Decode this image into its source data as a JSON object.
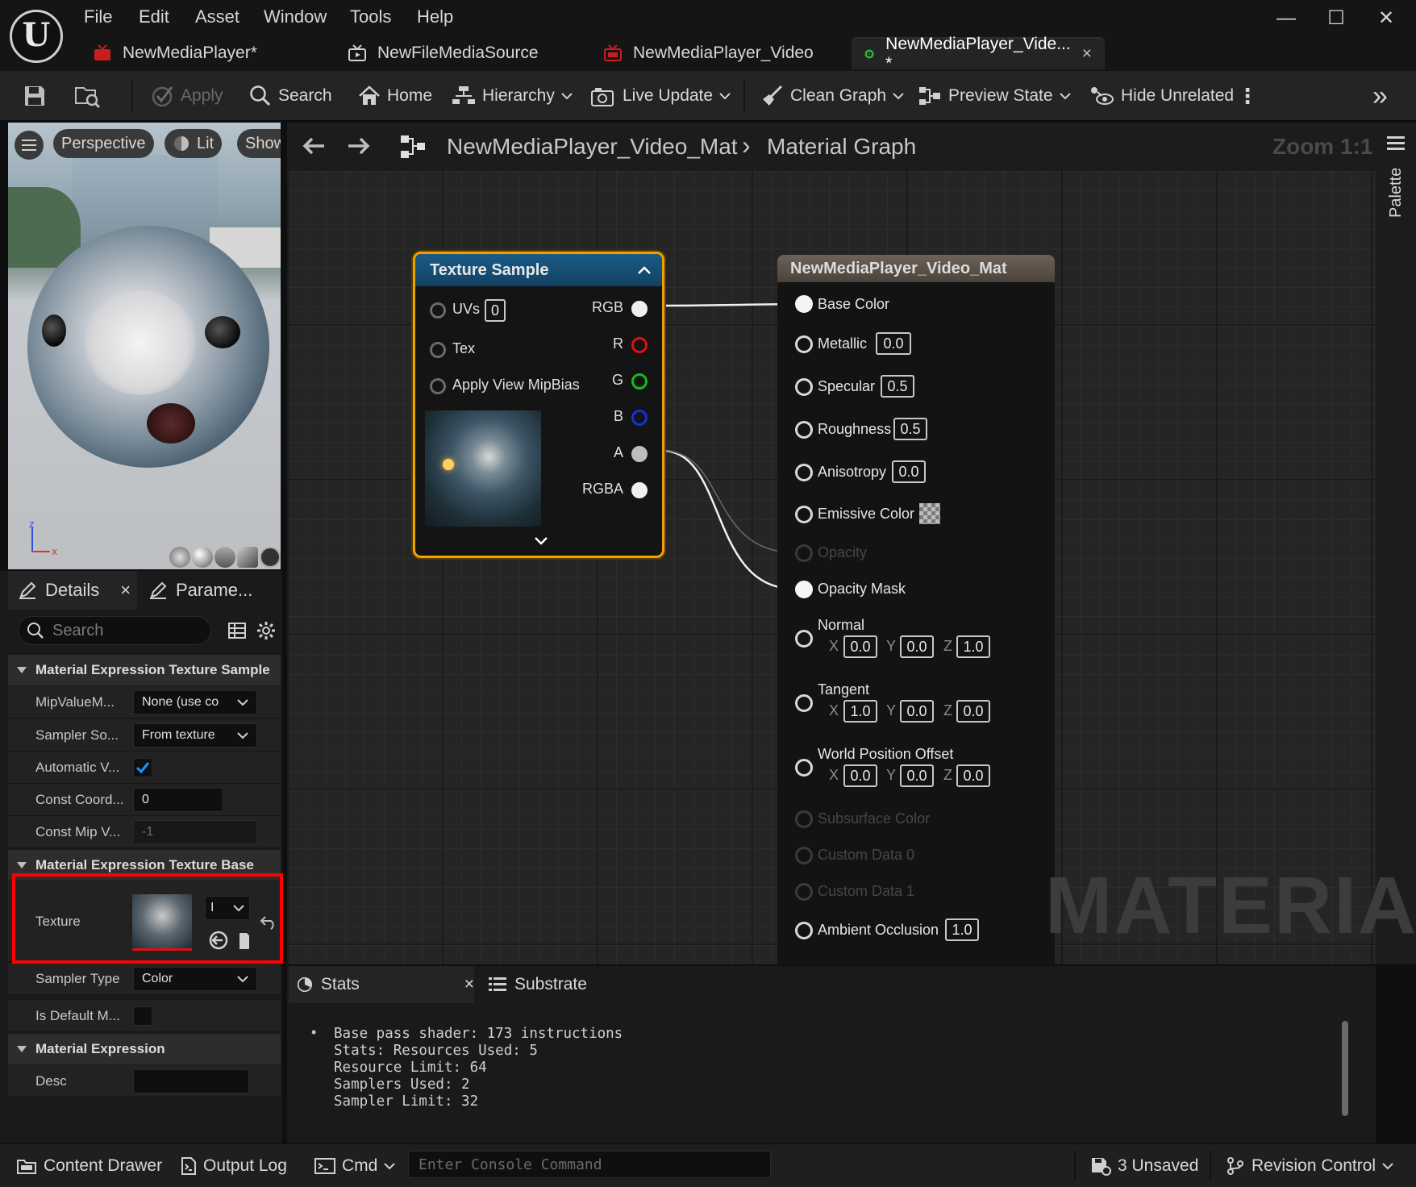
{
  "menu": [
    "File",
    "Edit",
    "Asset",
    "Window",
    "Tools",
    "Help"
  ],
  "window_controls": {
    "minimize": "—",
    "maximize": "☐",
    "close": "✕"
  },
  "tabs": [
    {
      "label": "NewMediaPlayer*"
    },
    {
      "label": "NewFileMediaSource"
    },
    {
      "label": "NewMediaPlayer_Video"
    },
    {
      "label": "NewMediaPlayer_Vide... *",
      "close": "×"
    }
  ],
  "toolbar": {
    "apply": "Apply",
    "search": "Search",
    "home": "Home",
    "hierarchy": "Hierarchy",
    "live_update": "Live Update",
    "clean_graph": "Clean Graph",
    "preview_state": "Preview State",
    "hide_unrelated": "Hide Unrelated",
    "more": "⋮",
    "expand": "»"
  },
  "viewport": {
    "perspective": "Perspective",
    "lit": "Lit",
    "show": "Show"
  },
  "details": {
    "tab_details": "Details",
    "tab_close": "×",
    "tab_parameters": "Parame...",
    "search_placeholder": "Search",
    "categories": {
      "texture_sample": "Material Expression Texture Sample",
      "texture_base": "Material Expression Texture Base",
      "expression": "Material Expression"
    },
    "rows": {
      "mip_value_mode": {
        "label": "MipValueM...",
        "value": "None (use co"
      },
      "sampler_source": {
        "label": "Sampler So...",
        "value": "From texture"
      },
      "automatic_view": {
        "label": "Automatic V...",
        "checked": true
      },
      "const_coord": {
        "label": "Const Coord...",
        "value": "0"
      },
      "const_mip": {
        "label": "Const Mip V...",
        "value": "-1"
      },
      "texture": {
        "label": "Texture",
        "value": "I"
      },
      "sampler_type": {
        "label": "Sampler Type",
        "value": "Color"
      },
      "is_default": {
        "label": "Is Default M..."
      },
      "desc": {
        "label": "Desc",
        "value": ""
      }
    }
  },
  "graph": {
    "breadcrumb_asset": "NewMediaPlayer_Video_Mat",
    "breadcrumb_sep": "›",
    "breadcrumb_graph": "Material Graph",
    "zoom": "Zoom 1:1",
    "palette": "Palette",
    "watermark": "MATERIAL",
    "texture_node": {
      "title": "Texture Sample",
      "inputs": {
        "uvs": "UVs",
        "uvs_value": "0",
        "tex": "Tex",
        "mipbias": "Apply View MipBias"
      },
      "outputs": [
        "RGB",
        "R",
        "G",
        "B",
        "A",
        "RGBA"
      ],
      "output_colors": [
        "#f0f0f0",
        "#e01010",
        "#10c010",
        "#1030e0",
        "#bdbdbd",
        "#f0f0f0"
      ]
    },
    "material_node": {
      "title": "NewMediaPlayer_Video_Mat",
      "base_color": "Base Color",
      "metallic": "Metallic",
      "metallic_value": "0.0",
      "specular": "Specular",
      "specular_value": "0.5",
      "roughness": "Roughness",
      "roughness_value": "0.5",
      "anisotropy": "Anisotropy",
      "anisotropy_value": "0.0",
      "emissive": "Emissive Color",
      "opacity": "Opacity",
      "opacity_mask": "Opacity Mask",
      "normal": {
        "label": "Normal",
        "x": "0.0",
        "y": "0.0",
        "z": "1.0"
      },
      "tangent": {
        "label": "Tangent",
        "x": "1.0",
        "y": "0.0",
        "z": "0.0"
      },
      "wpo": {
        "label": "World Position Offset",
        "x": "0.0",
        "y": "0.0",
        "z": "0.0"
      },
      "axis_x": "X",
      "axis_y": "Y",
      "axis_z": "Z",
      "subsurface": "Subsurface Color",
      "custom0": "Custom Data 0",
      "custom1": "Custom Data 1",
      "ao": "Ambient Occlusion",
      "ao_value": "1.0"
    }
  },
  "stats": {
    "tab_stats": "Stats",
    "tab_close": "×",
    "tab_substrate": "Substrate",
    "bullet": "•",
    "lines": [
      "Base pass shader: 173 instructions",
      "Stats: Resources Used: 5",
      "Resource Limit: 64",
      "Samplers Used: 2",
      "Sampler Limit: 32"
    ]
  },
  "bottombar": {
    "content_drawer": "Content Drawer",
    "output_log": "Output Log",
    "cmd": "Cmd",
    "console_placeholder": "Enter Console Command",
    "unsaved": "3 Unsaved",
    "revision": "Revision Control"
  }
}
